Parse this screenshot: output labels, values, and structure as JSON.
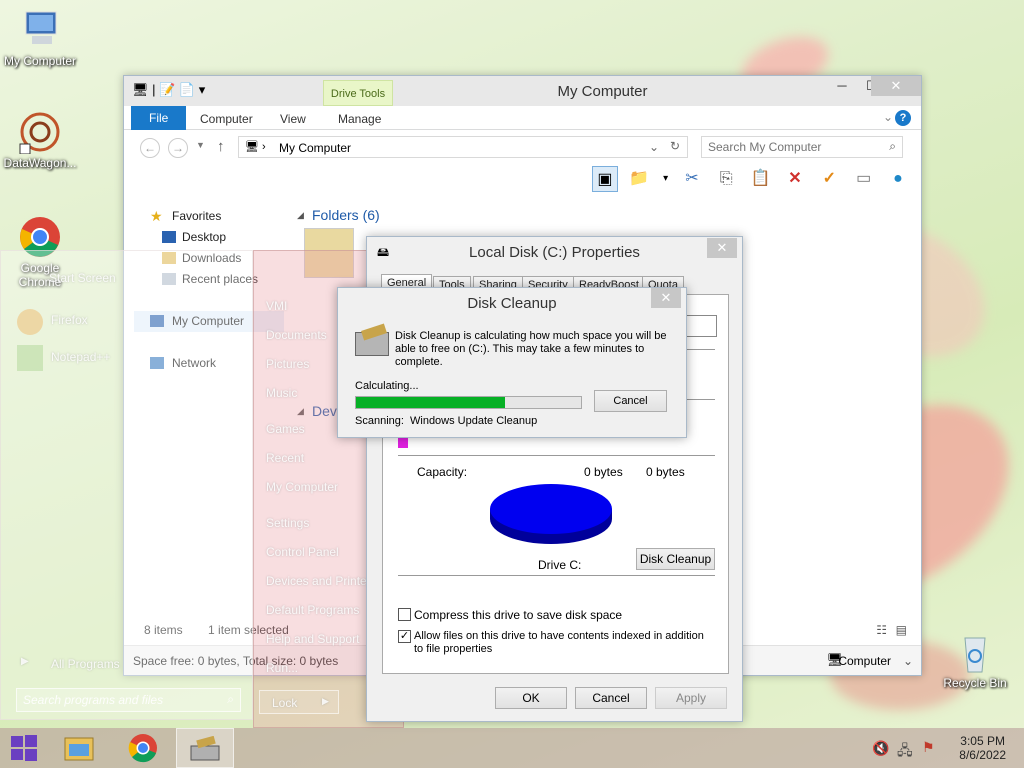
{
  "desktop": {
    "icons": [
      {
        "label": "My Computer"
      },
      {
        "label": "DataWagon..."
      },
      {
        "label": "Google Chrome"
      },
      {
        "label": "Recycle Bin"
      }
    ]
  },
  "explorer": {
    "title": "My Computer",
    "tabs": {
      "file": "File",
      "computer": "Computer",
      "view": "View",
      "manage": "Manage",
      "drive_tools": "Drive Tools"
    },
    "address": "My Computer",
    "search_placeholder": "Search My Computer",
    "nav": {
      "favorites": "Favorites",
      "desktop": "Desktop",
      "downloads": "Downloads",
      "recent": "Recent places",
      "my_computer": "My Computer",
      "network": "Network"
    },
    "folders_header": "Folders (6)",
    "devices_header": "Dev",
    "status_items": "8 items",
    "status_selected": "1 item selected",
    "space_line": "Space free: 0 bytes, Total size: 0 bytes",
    "detail_computer": "Computer"
  },
  "start_menu": {
    "start_screen": "Start Screen",
    "firefox": "Firefox",
    "notepad": "Notepad++",
    "all_programs": "All Programs",
    "search_placeholder": "Search programs and files",
    "right": [
      "VMI",
      "Documents",
      "Pictures",
      "Music",
      "Games",
      "Recent",
      "My Computer",
      "Settings",
      "Control Panel",
      "Devices and Printers",
      "Default Programs",
      "Help and Support",
      "Run..."
    ],
    "lock": "Lock"
  },
  "properties": {
    "title": "Local Disk (C:) Properties",
    "tabs": [
      "General",
      "Tools",
      "Sharing",
      "Security",
      "ReadyBoost",
      "Quota"
    ],
    "capacity_label": "Capacity:",
    "capacity_bytes": "0 bytes",
    "capacity_value": "0 bytes",
    "drive_label": "Drive C:",
    "disk_cleanup_btn": "Disk Cleanup",
    "compress_label": "Compress this drive to save disk space",
    "index_label": "Allow files on this drive to have contents indexed in addition to file properties",
    "compress_checked": false,
    "index_checked": true,
    "ok": "OK",
    "cancel": "Cancel",
    "apply": "Apply"
  },
  "cleanup": {
    "title": "Disk Cleanup",
    "message": "Disk Cleanup is calculating how much space you will be able to free on  (C:). This may take a few minutes to complete.",
    "calculating": "Calculating...",
    "cancel": "Cancel",
    "scanning_label": "Scanning:",
    "scanning_item": "Windows Update Cleanup",
    "progress": 0.66
  },
  "taskbar": {
    "time": "3:05 PM",
    "date": "8/6/2022"
  },
  "colors": {
    "pie": "#0000f0",
    "pie_shadow": "#00009a",
    "progress": "#06b025",
    "file_tab": "#1979ca"
  }
}
